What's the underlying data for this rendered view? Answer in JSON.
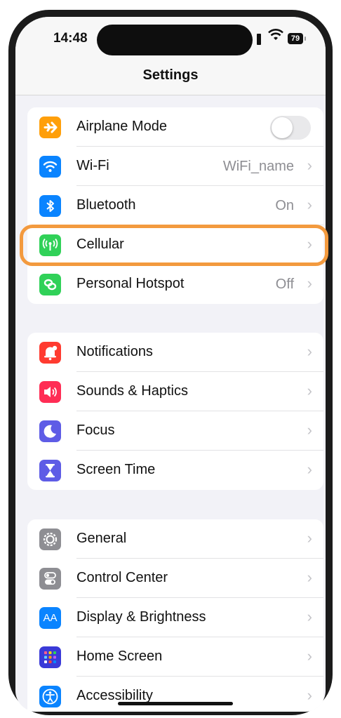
{
  "status": {
    "time": "14:48",
    "battery": "79"
  },
  "header": {
    "title": "Settings"
  },
  "groups": [
    {
      "rows": [
        {
          "label": "Airplane Mode",
          "color": "#ff9f0a",
          "icon": "airplane-icon"
        },
        {
          "label": "Wi-Fi",
          "value": "WiFi_name",
          "color": "#0a84ff",
          "icon": "wifi-icon"
        },
        {
          "label": "Bluetooth",
          "value": "On",
          "color": "#0a84ff",
          "icon": "bluetooth-icon"
        },
        {
          "label": "Cellular",
          "color": "#30d158",
          "icon": "antenna-icon"
        },
        {
          "label": "Personal Hotspot",
          "value": "Off",
          "color": "#30d158",
          "icon": "hotspot-icon"
        }
      ]
    },
    {
      "rows": [
        {
          "label": "Notifications",
          "color": "#ff3b30",
          "icon": "bell-icon"
        },
        {
          "label": "Sounds & Haptics",
          "color": "#ff2d55",
          "icon": "speaker-icon"
        },
        {
          "label": "Focus",
          "color": "#5e5ce6",
          "icon": "moon-icon"
        },
        {
          "label": "Screen Time",
          "color": "#5e5ce6",
          "icon": "hourglass-icon"
        }
      ]
    },
    {
      "rows": [
        {
          "label": "General",
          "color": "#8e8e93",
          "icon": "gear-icon"
        },
        {
          "label": "Control Center",
          "color": "#8e8e93",
          "icon": "toggles-icon"
        },
        {
          "label": "Display & Brightness",
          "value": "",
          "icon_text": "AA",
          "color": "#0a84ff",
          "icon": "text-size-icon"
        },
        {
          "label": "Home Screen",
          "color": "#3a3ad8",
          "icon": "app-grid-icon"
        },
        {
          "label": "Accessibility",
          "color": "#0a84ff",
          "icon": "accessibility-icon"
        }
      ]
    }
  ],
  "highlight": {
    "color": "#f39a3e"
  }
}
